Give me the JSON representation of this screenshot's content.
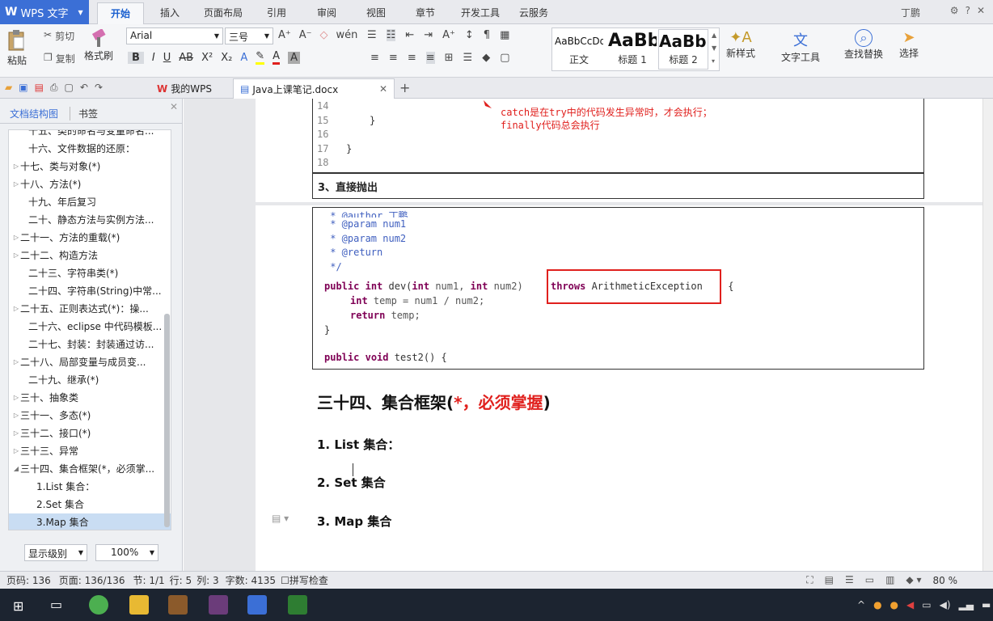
{
  "app": {
    "name": "WPS 文字"
  },
  "menu": {
    "items": [
      "开始",
      "插入",
      "页面布局",
      "引用",
      "审阅",
      "视图",
      "章节",
      "开发工具",
      "云服务"
    ],
    "active": "开始",
    "user": "丁鹏"
  },
  "ribbon": {
    "paste": "粘贴",
    "cut": "剪切",
    "copy": "复制",
    "format_painter": "格式刷",
    "font_name": "Arial",
    "font_size": "三号",
    "styles": [
      {
        "preview": "AaBbCcDd",
        "label": "正文"
      },
      {
        "preview": "AaBb",
        "label": "标题 1"
      },
      {
        "preview": "AaBb(",
        "label": "标题 2"
      }
    ],
    "new_style": "新样式",
    "text_tools": "文字工具",
    "find_replace": "查找替换",
    "select": "选择"
  },
  "tabs": {
    "wps": "我的WPS",
    "doc": "Java上课笔记.docx"
  },
  "nav": {
    "tab_outline": "文档结构图",
    "tab_bookmark": "书签",
    "items": [
      {
        "text": "十五、类的命名与变量命名...",
        "indent": 1,
        "tri": ""
      },
      {
        "text": "十六、文件数据的还原：",
        "indent": 1,
        "tri": ""
      },
      {
        "text": "十七、类与对象(*)",
        "indent": 0,
        "tri": "▷"
      },
      {
        "text": "十八、方法(*)",
        "indent": 0,
        "tri": "▷"
      },
      {
        "text": "十九、年后复习",
        "indent": 1,
        "tri": ""
      },
      {
        "text": "二十、静态方法与实例方法...",
        "indent": 1,
        "tri": ""
      },
      {
        "text": "二十一、方法的重载(*)",
        "indent": 0,
        "tri": "▷"
      },
      {
        "text": "二十二、构造方法",
        "indent": 0,
        "tri": "▷"
      },
      {
        "text": "二十三、字符串类(*)",
        "indent": 1,
        "tri": ""
      },
      {
        "text": "二十四、字符串(String)中常...",
        "indent": 1,
        "tri": ""
      },
      {
        "text": "二十五、正则表达式(*)：操...",
        "indent": 0,
        "tri": "▷"
      },
      {
        "text": "二十六、eclipse 中代码模板...",
        "indent": 1,
        "tri": ""
      },
      {
        "text": "二十七、封装：封装通过访...",
        "indent": 1,
        "tri": ""
      },
      {
        "text": "二十八、局部变量与成员变...",
        "indent": 0,
        "tri": "▷"
      },
      {
        "text": "二十九、继承(*)",
        "indent": 1,
        "tri": ""
      },
      {
        "text": "三十、抽象类",
        "indent": 0,
        "tri": "▷"
      },
      {
        "text": "三十一、多态(*)",
        "indent": 0,
        "tri": "▷"
      },
      {
        "text": "三十二、接口(*)",
        "indent": 0,
        "tri": "▷"
      },
      {
        "text": "三十三、异常",
        "indent": 0,
        "tri": "▷"
      },
      {
        "text": "三十四、集合框架(*，必须掌...",
        "indent": 0,
        "tri": "◢"
      },
      {
        "text": "1.List 集合：",
        "indent": 2,
        "tri": ""
      },
      {
        "text": "2.Set 集合",
        "indent": 2,
        "tri": ""
      },
      {
        "text": "3.Map 集合",
        "indent": 2,
        "tri": "",
        "selected": true
      }
    ],
    "level_label": "显示级别",
    "zoom_label": "100%"
  },
  "doc": {
    "code1": [
      {
        "n": "14",
        "code": ""
      },
      {
        "n": "15",
        "code": "    }"
      },
      {
        "n": "16",
        "code": ""
      },
      {
        "n": "17",
        "code": "}"
      },
      {
        "n": "18",
        "code": ""
      }
    ],
    "annotation_line1": "catch是在try中的代码发生异常时，才会执行；",
    "annotation_line2": "finally代码总会执行",
    "section_3": "3、直接抛出",
    "code2_comments": [
      " * @author 丁鹏",
      " * @param num1",
      " * @param num2",
      " * @return",
      " */"
    ],
    "code2_sig_kw1": "public",
    "code2_sig_kw2": "int",
    "code2_sig_name": " dev(",
    "code2_sig_kw3": "int",
    "code2_sig_p1": " num1, ",
    "code2_sig_kw4": "int",
    "code2_sig_p2": " num2) ",
    "code2_throws_kw": "throws",
    "code2_throws_ex": " ArithmeticException",
    "code2_sig_end": " {",
    "code2_line2_kw": "int",
    "code2_line2_rest": " temp = num1 / num2;",
    "code2_line3_kw": "return",
    "code2_line3_rest": " temp;",
    "code2_close": "}",
    "code2_last_kw1": "public",
    "code2_last_kw2": "void",
    "code2_last_rest": " test2() {",
    "heading_black": "三十四、集合框架(",
    "heading_red": "*，必须掌握",
    "heading_close": ")",
    "sub1": "1.  List 集合：",
    "sub2": "2.  Set 集合",
    "sub3": "3.  Map 集合"
  },
  "status": {
    "page_num": "页码: 136",
    "pages": "页面: 136/136",
    "section": "节: 1/1",
    "row": "行: 5",
    "col": "列: 3",
    "words": "字数: 4135",
    "spell": "拼写检查",
    "zoom": "80 %"
  },
  "colors": {
    "accent": "#3b6fd6",
    "red": "#e0201d",
    "keyword": "#7f0055",
    "comment": "#3f5fbf"
  }
}
